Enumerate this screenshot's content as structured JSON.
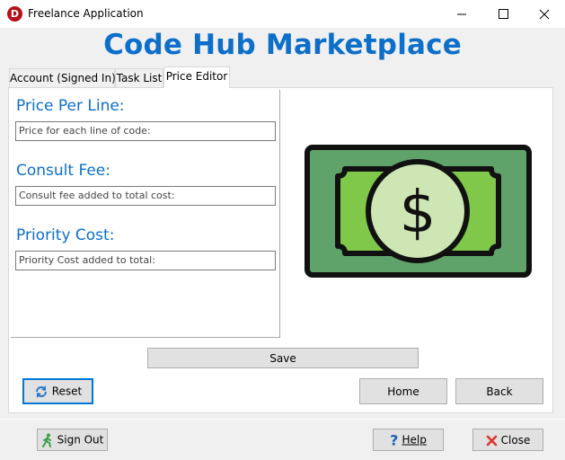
{
  "window": {
    "title": "Freelance Application",
    "app_icon": "app-logo-icon",
    "app_icon_letter": "D",
    "controls": [
      "minimize-icon",
      "maximize-icon",
      "close-icon"
    ]
  },
  "header": {
    "title": "Code Hub Marketplace",
    "color": "#0d6fc9"
  },
  "tabs": [
    {
      "label": "Account (Signed In)",
      "active": false
    },
    {
      "label": "Task List",
      "active": false
    },
    {
      "label": "Price Editor",
      "active": true
    }
  ],
  "form": {
    "price_per_line": {
      "label": "Price Per Line:",
      "placeholder": "Price for each line of code:"
    },
    "consult_fee": {
      "label": "Consult Fee:",
      "placeholder": "Consult fee added to total cost:"
    },
    "priority_cost": {
      "label": "Priority Cost:",
      "placeholder": "Priority Cost added to total:"
    }
  },
  "illustration": {
    "icon": "dollar-bill-icon",
    "symbol": "$"
  },
  "buttons": {
    "save": "Save",
    "reset": "Reset",
    "home": "Home",
    "back": "Back",
    "sign_out": "Sign Out",
    "help": "Help",
    "close": "Close"
  },
  "colors": {
    "accent": "#0d6fc9",
    "bill_dark_green": "#5fa36a",
    "bill_light_green": "#7fc84a",
    "coin_fill": "#cde6b3",
    "close_red": "#e0322b",
    "help_blue": "#1f5fb4"
  }
}
